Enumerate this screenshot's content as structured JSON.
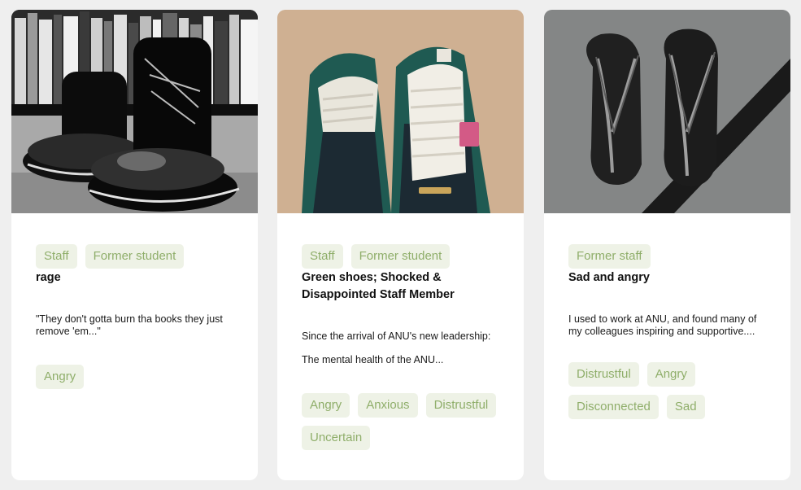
{
  "cards": [
    {
      "image_alt": "Black leather boots in front of a bookshelf",
      "roles": [
        "Staff",
        "Former student"
      ],
      "title": "rage",
      "excerpt": "\"They don't gotta burn tha books they just remove 'em...\"",
      "emotions": [
        "Angry"
      ]
    },
    {
      "image_alt": "Green sneakers with white laces",
      "roles": [
        "Staff",
        "Former student"
      ],
      "title": "Green shoes; Shocked & Disappointed Staff Member",
      "excerpt": "Since the arrival of ANU's new leadership:\n\nThe mental health of the ANU...",
      "emotions": [
        "Angry",
        "Anxious",
        "Distrustful",
        "Uncertain"
      ]
    },
    {
      "image_alt": "Black thongs on concrete",
      "roles": [
        "Former staff"
      ],
      "title": "Sad and angry",
      "excerpt": "I used to work at ANU, and found many of my colleagues inspiring and supportive....",
      "emotions": [
        "Distrustful",
        "Angry",
        "Disconnected",
        "Sad"
      ]
    }
  ]
}
